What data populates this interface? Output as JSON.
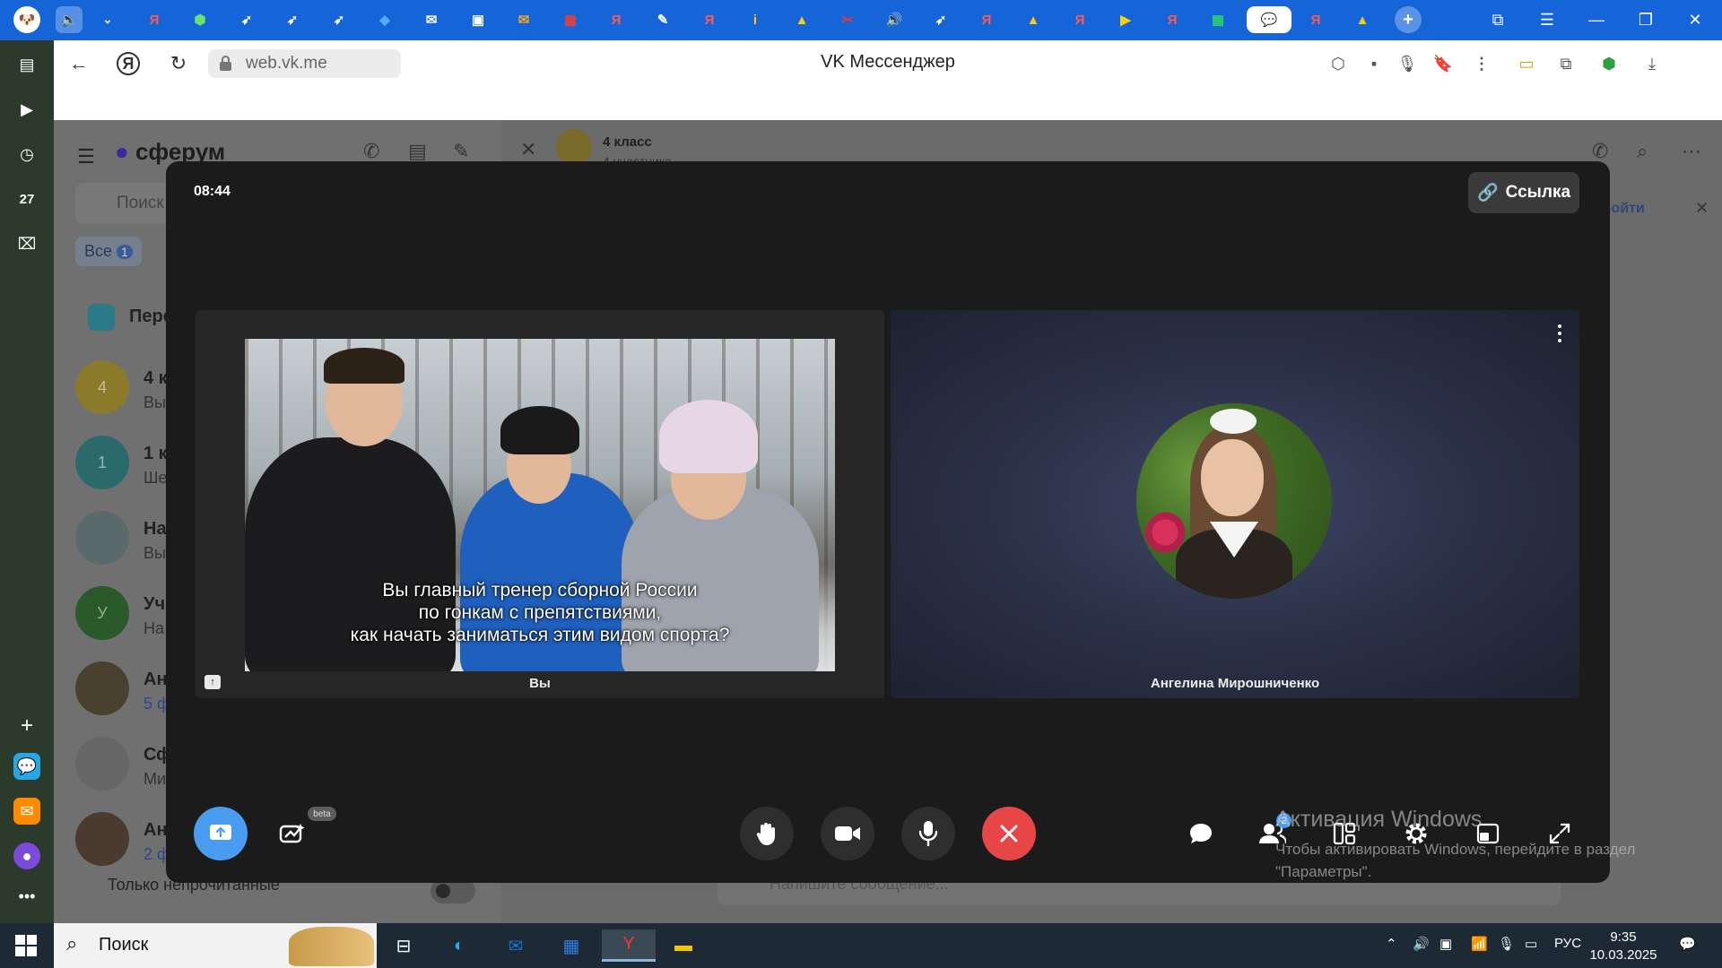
{
  "browser": {
    "url": "web.vk.me",
    "page_title": "VK Мессенджер",
    "extensions_count": "1",
    "downloads_count": "6"
  },
  "sidebar": {
    "calendar_day": "27"
  },
  "vk": {
    "brand": "сферум",
    "search_placeholder": "Поиск",
    "filter_all": "Все",
    "filter_all_count": "1",
    "folder_label": "Пере",
    "chat_title": "4 класс",
    "chat_subtitle": "4 участника",
    "join_button": "Войти",
    "message_placeholder": "Напишите сообщение...",
    "chats": [
      {
        "avatar_letter": "4",
        "name": "4 к",
        "preview": "Вы"
      },
      {
        "avatar_letter": "1",
        "name": "1 к",
        "preview": "Ше"
      },
      {
        "avatar_letter": "",
        "name": "На",
        "preview": "Вы"
      },
      {
        "avatar_letter": "У",
        "name": "Уч",
        "preview": "На"
      },
      {
        "avatar_letter": "",
        "name": "Ан",
        "preview": "5 ф"
      },
      {
        "avatar_letter": "",
        "name": "Сф",
        "preview": "Ми"
      },
      {
        "avatar_letter": "",
        "name": "Ан",
        "preview": "2 ф"
      }
    ],
    "unread_only_label": "Только непрочитанные"
  },
  "call": {
    "timer": "08:44",
    "link_button": "Ссылка",
    "self_label": "Вы",
    "subtitles": [
      "Вы главный тренер сборной России",
      "по гонкам с препятствиями,",
      "как начать заниматься этим видом спорта?"
    ],
    "other_participant": "Ангелина Мирошниченко",
    "beta_badge": "beta",
    "participants_count": "2"
  },
  "watermark": {
    "title": "Активация Windows",
    "line1": "Чтобы активировать Windows, перейдите в раздел",
    "line2": "\"Параметры\"."
  },
  "taskbar": {
    "search_label": "Поиск",
    "lang": "РУС",
    "time": "9:35",
    "date": "10.03.2025",
    "notif_count": "1"
  },
  "colors": {
    "accent_blue": "#4a9cf0",
    "end_call_red": "#e64646",
    "tabstrip": "#1565d8"
  }
}
